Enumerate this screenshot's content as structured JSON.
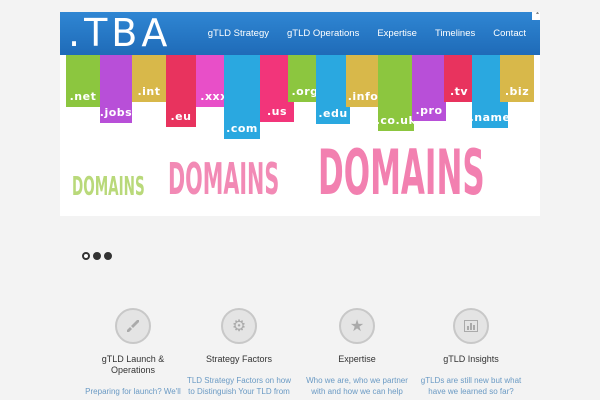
{
  "header": {
    "logo": ".TBA",
    "nav": [
      "gTLD Strategy",
      "gTLD Operations",
      "Expertise",
      "Timelines",
      "Contact"
    ]
  },
  "banner": {
    "tags": [
      ".net",
      ".jobs",
      ".int",
      ".eu",
      ".xxx",
      ".com",
      ".us",
      ".org",
      ".edu",
      ".info",
      ".co.uk",
      ".pro",
      ".tv",
      ".name",
      ".biz"
    ],
    "words": [
      "DOMAINS",
      "DOMAINS",
      "DOMAINS"
    ]
  },
  "slider": {
    "dots": 3,
    "active": 0
  },
  "features": [
    {
      "icon": "rocket-icon",
      "title": "gTLD Launch &\nOperations",
      "text": "Preparing for launch?  We'll"
    },
    {
      "icon": "gears-icon",
      "title": "Strategy Factors",
      "text": "TLD Strategy Factors on how to Distinguish Your TLD from"
    },
    {
      "icon": "star-icon",
      "title": "Expertise",
      "text": "Who we are, who we partner with and how we can help"
    },
    {
      "icon": "chart-icon",
      "title": "gTLD Insights",
      "text": "gTLDs are still new but what have we learned so far?"
    }
  ],
  "colors": {
    "header": "#2b7fcf",
    "link": "#6a9ac4"
  }
}
